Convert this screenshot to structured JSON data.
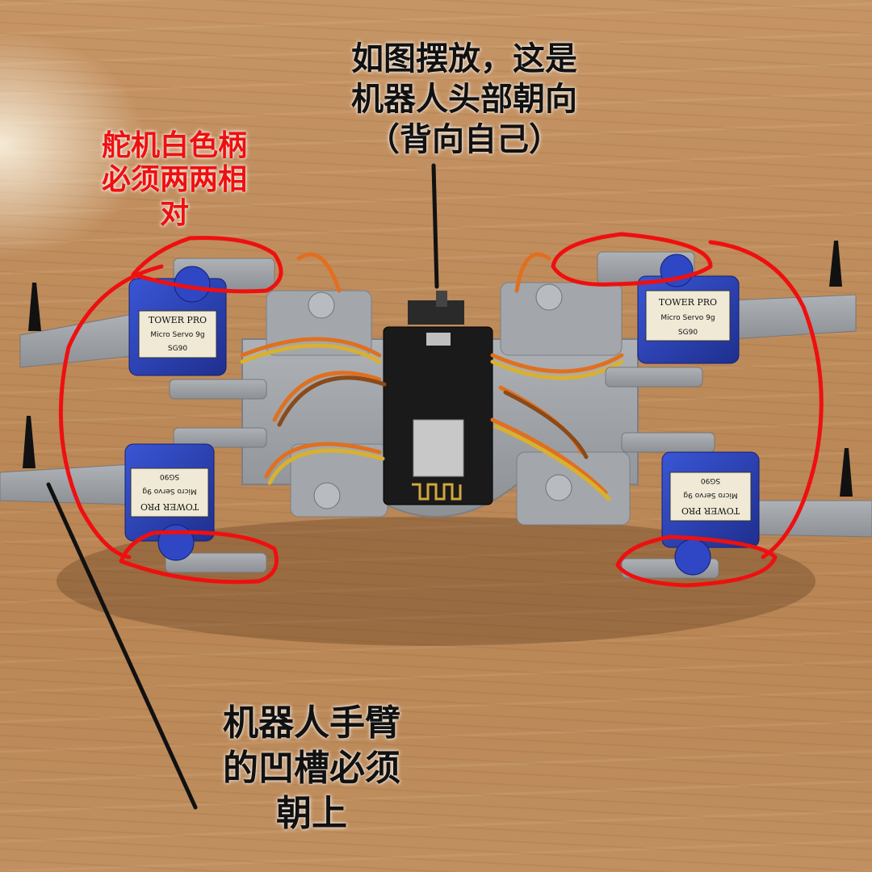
{
  "annotations": {
    "head_direction": "如图摆放，这是\n机器人头部朝向\n（背向自己）",
    "servo_horn": "舵机白色柄\n必须两两相\n对",
    "arm_groove": "机器人手臂\n的凹槽必须\n朝上"
  },
  "servo_labels": {
    "brand": "TOWER PRO",
    "model": "Micro Servo 9g",
    "part": "SG90"
  },
  "colors": {
    "annotation_red": "#ee1010",
    "annotation_black": "#111111",
    "servo_blue": "#2a3fb0",
    "frame_grey": "#9a9ea3",
    "board_black": "#1a1a1a"
  }
}
